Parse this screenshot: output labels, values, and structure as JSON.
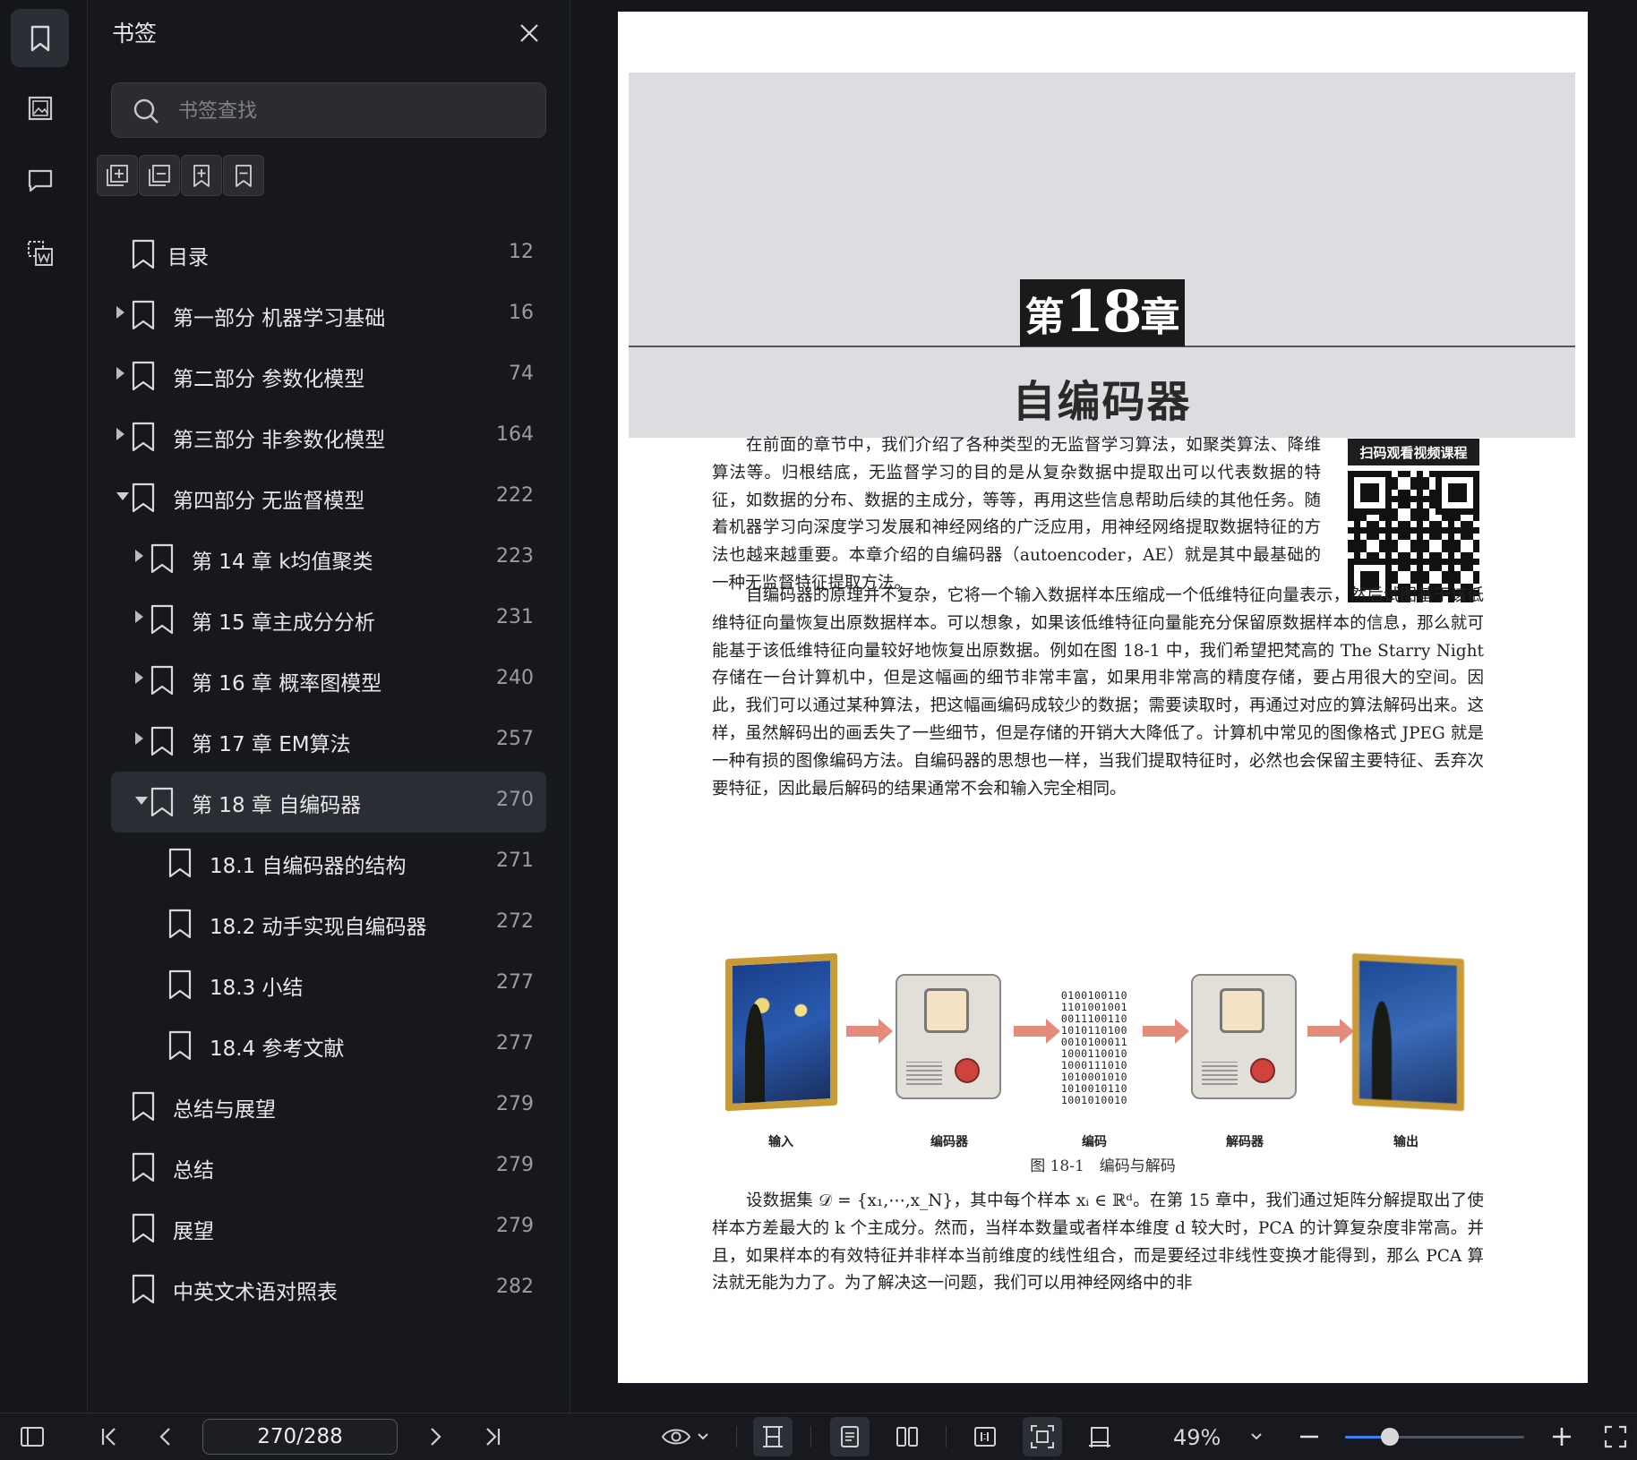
{
  "sidebar_panel": {
    "title": "书签",
    "search_placeholder": "书签查找",
    "tools": [
      "expand-all-icon",
      "collapse-all-icon",
      "add-bookmark-icon",
      "remove-bookmark-icon"
    ]
  },
  "bookmarks": [
    {
      "label": "目录",
      "page": "12",
      "level": 0,
      "caret": "none"
    },
    {
      "label": "第一部分 机器学习基础",
      "page": "16",
      "level": 0,
      "caret": "right"
    },
    {
      "label": "第二部分 参数化模型",
      "page": "74",
      "level": 0,
      "caret": "right"
    },
    {
      "label": "第三部分 非参数化模型",
      "page": "164",
      "level": 0,
      "caret": "right"
    },
    {
      "label": "第四部分 无监督模型",
      "page": "222",
      "level": 0,
      "caret": "down"
    },
    {
      "label": "第 14 章 k均值聚类",
      "page": "223",
      "level": 1,
      "caret": "right"
    },
    {
      "label": "第 15 章主成分分析",
      "page": "231",
      "level": 1,
      "caret": "right"
    },
    {
      "label": "第 16 章 概率图模型",
      "page": "240",
      "level": 1,
      "caret": "right"
    },
    {
      "label": "第 17 章 EM算法",
      "page": "257",
      "level": 1,
      "caret": "right"
    },
    {
      "label": "第 18 章 自编码器",
      "page": "270",
      "level": 1,
      "caret": "down",
      "selected": true
    },
    {
      "label": "18.1 自编码器的结构",
      "page": "271",
      "level": 2,
      "caret": "none"
    },
    {
      "label": "18.2 动手实现自编码器",
      "page": "272",
      "level": 2,
      "caret": "none"
    },
    {
      "label": "18.3 小结",
      "page": "277",
      "level": 2,
      "caret": "none"
    },
    {
      "label": "18.4 参考文献",
      "page": "277",
      "level": 2,
      "caret": "none"
    },
    {
      "label": "总结与展望",
      "page": "279",
      "level": 0,
      "caret": "none"
    },
    {
      "label": "总结",
      "page": "279",
      "level": 0,
      "caret": "none"
    },
    {
      "label": "展望",
      "page": "279",
      "level": 0,
      "caret": "none"
    },
    {
      "label": "中英文术语对照表",
      "page": "282",
      "level": 0,
      "caret": "none"
    }
  ],
  "document": {
    "chapter_prefix": "第",
    "chapter_number": "18",
    "chapter_suffix": "章",
    "chapter_title": "自编码器",
    "qr_label": "扫码观看视频课程",
    "para1": "在前面的章节中，我们介绍了各种类型的无监督学习算法，如聚类算法、降维算法等。归根结底，无监督学习的目的是从复杂数据中提取出可以代表数据的特征，如数据的分布、数据的主成分，等等，再用这些信息帮助后续的其他任务。随着机器学习向深度学习发展和神经网络的广泛应用，用神经网络提取数据特征的方法也越来越重要。本章介绍的自编码器（autoencoder，AE）就是其中最基础的一种无监督特征提取方法。",
    "para2": "自编码器的原理并不复杂，它将一个输入数据样本压缩成一个低维特征向量表示，然后试图基于该低维特征向量恢复出原数据样本。可以想象，如果该低维特征向量能充分保留原数据样本的信息，那么就可能基于该低维特征向量较好地恢复出原数据。例如在图 18-1 中，我们希望把梵高的 The Starry Night 存储在一台计算机中，但是这幅画的细节非常丰富，如果用非常高的精度存储，要占用很大的空间。因此，我们可以通过某种算法，把这幅画编码成较少的数据；需要读取时，再通过对应的算法解码出来。这样，虽然解码出的画丢失了一些细节，但是存储的开销大大降低了。计算机中常见的图像格式 JPEG 就是一种有损的图像编码方法。自编码器的思想也一样，当我们提取特征时，必然也会保留主要特征、丢弃次要特征，因此最后解码的结果通常不会和输入完全相同。",
    "figure_labels": [
      "输入",
      "编码器",
      "编码",
      "解码器",
      "输出"
    ],
    "figure_bits": [
      "0100100110",
      "1101001001",
      "0011100110",
      "1010110100",
      "0010100011",
      "1000110010",
      "1000111010",
      "1010001010",
      "1010010110",
      "1001010010"
    ],
    "figure_caption": "图 18-1　编码与解码",
    "para3": "设数据集 𝒟 = {x₁,⋯,x_N}，其中每个样本 xᵢ ∈ ℝᵈ。在第 15 章中，我们通过矩阵分解提取出了使样本方差最大的 k 个主成分。然而，当样本数量或者样本维度 d 较大时，PCA 的计算复杂度非常高。并且，如果样本的有效特征并非样本当前维度的线性组合，而是要经过非线性变换才能得到，那么 PCA 算法就无能为力了。为了解决这一问题，我们可以用神经网络中的非"
  },
  "toolbar": {
    "page_indicator": "270/288",
    "zoom": "49%",
    "zoom_fraction": 0.25
  }
}
